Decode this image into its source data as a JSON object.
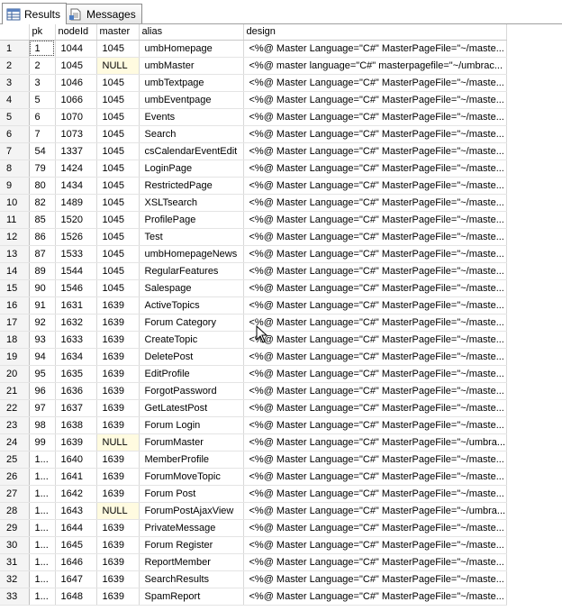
{
  "tabs": [
    {
      "label": "Results",
      "active": true,
      "icon": "results-grid-icon"
    },
    {
      "label": "Messages",
      "active": false,
      "icon": "messages-document-icon"
    }
  ],
  "columns": [
    "pk",
    "nodeId",
    "master",
    "alias",
    "design"
  ],
  "rows": [
    {
      "n": "1",
      "pk": "1",
      "nodeId": "1044",
      "master": "1045",
      "alias": "umbHomepage",
      "design": "<%@ Master Language=\"C#\" MasterPageFile=\"~/maste..."
    },
    {
      "n": "2",
      "pk": "2",
      "nodeId": "1045",
      "master": "NULL",
      "alias": "umbMaster",
      "design": "<%@ master language=\"C#\" masterpagefile=\"~/umbrac..."
    },
    {
      "n": "3",
      "pk": "3",
      "nodeId": "1046",
      "master": "1045",
      "alias": "umbTextpage",
      "design": "<%@ Master Language=\"C#\" MasterPageFile=\"~/maste..."
    },
    {
      "n": "4",
      "pk": "5",
      "nodeId": "1066",
      "master": "1045",
      "alias": "umbEventpage",
      "design": "<%@ Master Language=\"C#\" MasterPageFile=\"~/maste..."
    },
    {
      "n": "5",
      "pk": "6",
      "nodeId": "1070",
      "master": "1045",
      "alias": "Events",
      "design": "<%@ Master Language=\"C#\" MasterPageFile=\"~/maste..."
    },
    {
      "n": "6",
      "pk": "7",
      "nodeId": "1073",
      "master": "1045",
      "alias": "Search",
      "design": "<%@ Master Language=\"C#\" MasterPageFile=\"~/maste..."
    },
    {
      "n": "7",
      "pk": "54",
      "nodeId": "1337",
      "master": "1045",
      "alias": "csCalendarEventEdit",
      "design": "<%@ Master Language=\"C#\" MasterPageFile=\"~/maste..."
    },
    {
      "n": "8",
      "pk": "79",
      "nodeId": "1424",
      "master": "1045",
      "alias": "LoginPage",
      "design": "<%@ Master Language=\"C#\" MasterPageFile=\"~/maste..."
    },
    {
      "n": "9",
      "pk": "80",
      "nodeId": "1434",
      "master": "1045",
      "alias": "RestrictedPage",
      "design": "<%@ Master Language=\"C#\" MasterPageFile=\"~/maste..."
    },
    {
      "n": "10",
      "pk": "82",
      "nodeId": "1489",
      "master": "1045",
      "alias": "XSLTsearch",
      "design": "<%@ Master Language=\"C#\" MasterPageFile=\"~/maste..."
    },
    {
      "n": "11",
      "pk": "85",
      "nodeId": "1520",
      "master": "1045",
      "alias": "ProfilePage",
      "design": "<%@ Master Language=\"C#\" MasterPageFile=\"~/maste..."
    },
    {
      "n": "12",
      "pk": "86",
      "nodeId": "1526",
      "master": "1045",
      "alias": "Test",
      "design": "<%@ Master Language=\"C#\" MasterPageFile=\"~/maste..."
    },
    {
      "n": "13",
      "pk": "87",
      "nodeId": "1533",
      "master": "1045",
      "alias": "umbHomepageNews",
      "design": "<%@ Master Language=\"C#\" MasterPageFile=\"~/maste..."
    },
    {
      "n": "14",
      "pk": "89",
      "nodeId": "1544",
      "master": "1045",
      "alias": "RegularFeatures",
      "design": "<%@ Master Language=\"C#\" MasterPageFile=\"~/maste..."
    },
    {
      "n": "15",
      "pk": "90",
      "nodeId": "1546",
      "master": "1045",
      "alias": "Salespage",
      "design": "<%@ Master Language=\"C#\" MasterPageFile=\"~/maste..."
    },
    {
      "n": "16",
      "pk": "91",
      "nodeId": "1631",
      "master": "1639",
      "alias": "ActiveTopics",
      "design": "<%@ Master Language=\"C#\" MasterPageFile=\"~/maste..."
    },
    {
      "n": "17",
      "pk": "92",
      "nodeId": "1632",
      "master": "1639",
      "alias": "Forum Category",
      "design": "<%@ Master Language=\"C#\" MasterPageFile=\"~/maste..."
    },
    {
      "n": "18",
      "pk": "93",
      "nodeId": "1633",
      "master": "1639",
      "alias": "CreateTopic",
      "design": "<%@ Master Language=\"C#\" MasterPageFile=\"~/maste..."
    },
    {
      "n": "19",
      "pk": "94",
      "nodeId": "1634",
      "master": "1639",
      "alias": "DeletePost",
      "design": "<%@ Master Language=\"C#\" MasterPageFile=\"~/maste..."
    },
    {
      "n": "20",
      "pk": "95",
      "nodeId": "1635",
      "master": "1639",
      "alias": "EditProfile",
      "design": "<%@ Master Language=\"C#\" MasterPageFile=\"~/maste..."
    },
    {
      "n": "21",
      "pk": "96",
      "nodeId": "1636",
      "master": "1639",
      "alias": "ForgotPassword",
      "design": "<%@ Master Language=\"C#\" MasterPageFile=\"~/maste..."
    },
    {
      "n": "22",
      "pk": "97",
      "nodeId": "1637",
      "master": "1639",
      "alias": "GetLatestPost",
      "design": "<%@ Master Language=\"C#\" MasterPageFile=\"~/maste..."
    },
    {
      "n": "23",
      "pk": "98",
      "nodeId": "1638",
      "master": "1639",
      "alias": "Forum Login",
      "design": "<%@ Master Language=\"C#\" MasterPageFile=\"~/maste..."
    },
    {
      "n": "24",
      "pk": "99",
      "nodeId": "1639",
      "master": "NULL",
      "alias": "ForumMaster",
      "design": "<%@ Master Language=\"C#\" MasterPageFile=\"~/umbra..."
    },
    {
      "n": "25",
      "pk": "1...",
      "nodeId": "1640",
      "master": "1639",
      "alias": "MemberProfile",
      "design": "<%@ Master Language=\"C#\" MasterPageFile=\"~/maste..."
    },
    {
      "n": "26",
      "pk": "1...",
      "nodeId": "1641",
      "master": "1639",
      "alias": "ForumMoveTopic",
      "design": "<%@ Master Language=\"C#\" MasterPageFile=\"~/maste..."
    },
    {
      "n": "27",
      "pk": "1...",
      "nodeId": "1642",
      "master": "1639",
      "alias": "Forum Post",
      "design": "<%@ Master Language=\"C#\" MasterPageFile=\"~/maste..."
    },
    {
      "n": "28",
      "pk": "1...",
      "nodeId": "1643",
      "master": "NULL",
      "alias": "ForumPostAjaxView",
      "design": "<%@ Master Language=\"C#\" MasterPageFile=\"~/umbra..."
    },
    {
      "n": "29",
      "pk": "1...",
      "nodeId": "1644",
      "master": "1639",
      "alias": "PrivateMessage",
      "design": "<%@ Master Language=\"C#\" MasterPageFile=\"~/maste..."
    },
    {
      "n": "30",
      "pk": "1...",
      "nodeId": "1645",
      "master": "1639",
      "alias": "Forum Register",
      "design": "<%@ Master Language=\"C#\" MasterPageFile=\"~/maste..."
    },
    {
      "n": "31",
      "pk": "1...",
      "nodeId": "1646",
      "master": "1639",
      "alias": "ReportMember",
      "design": "<%@ Master Language=\"C#\" MasterPageFile=\"~/maste..."
    },
    {
      "n": "32",
      "pk": "1...",
      "nodeId": "1647",
      "master": "1639",
      "alias": "SearchResults",
      "design": "<%@ Master Language=\"C#\" MasterPageFile=\"~/maste..."
    },
    {
      "n": "33",
      "pk": "1...",
      "nodeId": "1648",
      "master": "1639",
      "alias": "SpamReport",
      "design": "<%@ Master Language=\"C#\" MasterPageFile=\"~/maste..."
    }
  ],
  "colors": {
    "null_cell": "#fffbe0",
    "row_header": "#f4f4f4",
    "grid_line": "#e4e4e4"
  }
}
